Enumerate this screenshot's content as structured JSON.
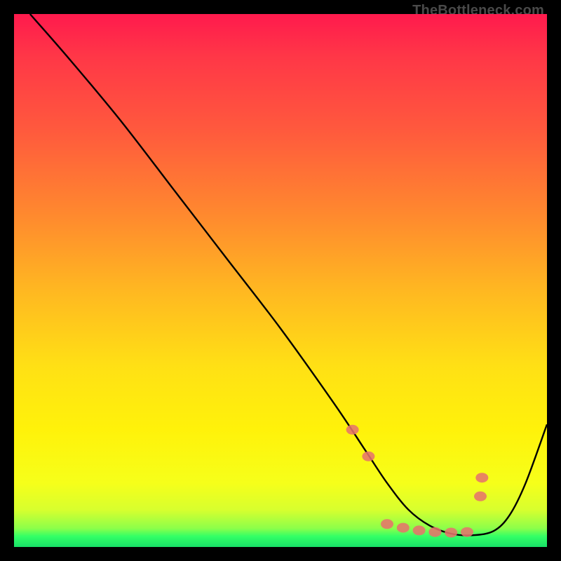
{
  "watermark": "TheBottleneck.com",
  "chart_data": {
    "type": "line",
    "title": "",
    "xlabel": "",
    "ylabel": "",
    "xlim": [
      0,
      100
    ],
    "ylim": [
      0,
      100
    ],
    "series": [
      {
        "name": "curve",
        "x": [
          3,
          10,
          20,
          30,
          40,
          50,
          60,
          66,
          70,
          74,
          78,
          82,
          86,
          90,
          93,
          96,
          100
        ],
        "y": [
          100,
          92,
          80,
          67,
          54,
          41,
          27,
          18,
          12,
          7,
          4,
          2.5,
          2.2,
          3,
          6,
          12,
          23
        ]
      }
    ],
    "markers": {
      "name": "highlight-dots",
      "x": [
        63.5,
        66.5,
        70,
        73,
        76,
        79,
        82,
        85,
        87.5,
        87.8
      ],
      "y": [
        22,
        17,
        4.3,
        3.6,
        3.1,
        2.8,
        2.7,
        2.8,
        9.5,
        13
      ]
    },
    "colors": {
      "gradient_top": "#ff1a4d",
      "gradient_mid": "#ffe015",
      "gradient_bottom": "#18e067",
      "curve": "#000000",
      "dot": "#e6746b"
    }
  }
}
